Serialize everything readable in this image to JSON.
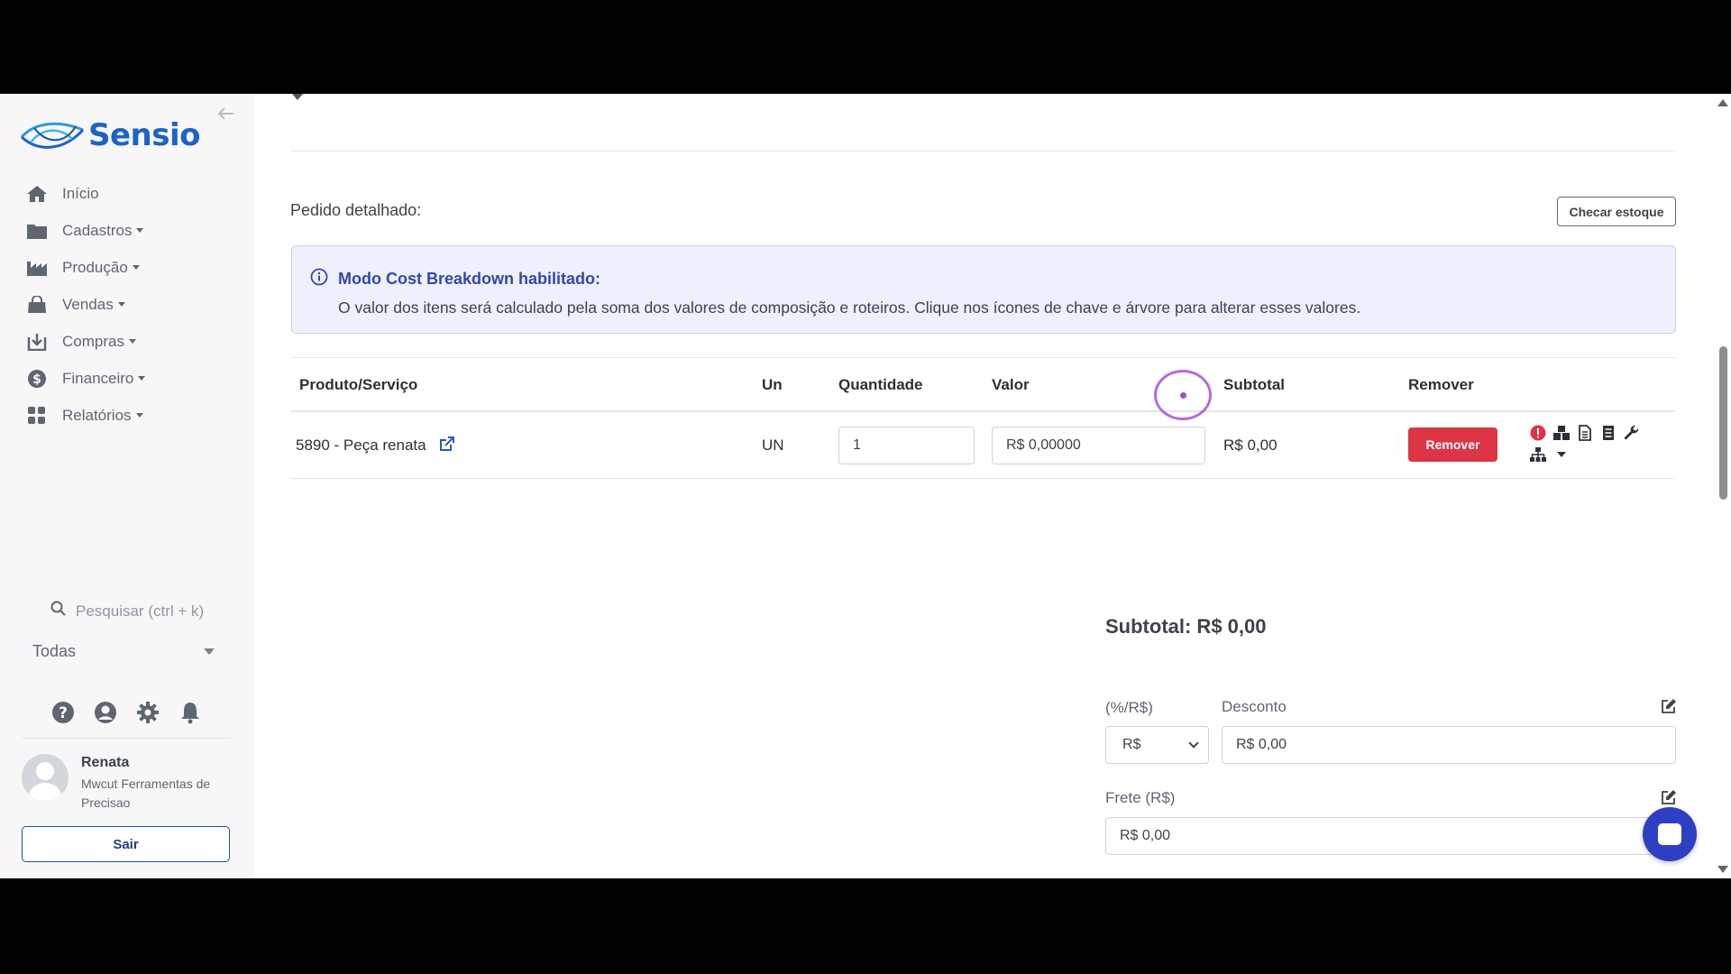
{
  "brand": {
    "name": "Sensio",
    "logo_color": "#1d63c8"
  },
  "sidebar": {
    "items": [
      {
        "label": "Início",
        "icon": "home-icon",
        "dropdown": false
      },
      {
        "label": "Cadastros",
        "icon": "folder-icon",
        "dropdown": true
      },
      {
        "label": "Produção",
        "icon": "factory-icon",
        "dropdown": true
      },
      {
        "label": "Vendas",
        "icon": "shopping-bag-icon",
        "dropdown": true
      },
      {
        "label": "Compras",
        "icon": "download-box-icon",
        "dropdown": true
      },
      {
        "label": "Financeiro",
        "icon": "dollar-circle-icon",
        "dropdown": true
      },
      {
        "label": "Relatórios",
        "icon": "grid-icon",
        "dropdown": true
      }
    ],
    "search_placeholder": "Pesquisar (ctrl + k)",
    "company_filter": "Todas",
    "user": {
      "name": "Renata",
      "company": "Mwcut Ferramentas de Precisao"
    },
    "logout_label": "Sair"
  },
  "main": {
    "section_label": "Pedido detalhado:",
    "check_stock_label": "Checar estoque",
    "alert": {
      "title": "Modo Cost Breakdown habilitado:",
      "body": "O valor dos itens será calculado pela soma dos valores de composição e roteiros. Clique nos ícones de chave e árvore para alterar esses valores."
    },
    "table": {
      "headers": [
        "Produto/Serviço",
        "Un",
        "Quantidade",
        "Valor",
        "Subtotal",
        "Remover"
      ],
      "rows": [
        {
          "product": "5890 - Peça renata",
          "unit": "UN",
          "quantity": "1",
          "value": "R$ 0,00000",
          "subtotal": "R$ 0,00",
          "remove_label": "Remover"
        }
      ]
    },
    "totals": {
      "subtotal": "Subtotal: R$ 0,00",
      "discount_type_label": "(%/R$)",
      "discount_type_value": "R$",
      "discount_label": "Desconto",
      "discount_value": "R$ 0,00",
      "freight_label": "Frete (R$)",
      "freight_value": "R$ 0,00"
    }
  },
  "colors": {
    "accent": "#3546ab",
    "danger": "#dc3545",
    "chat": "#2f3fc4"
  }
}
